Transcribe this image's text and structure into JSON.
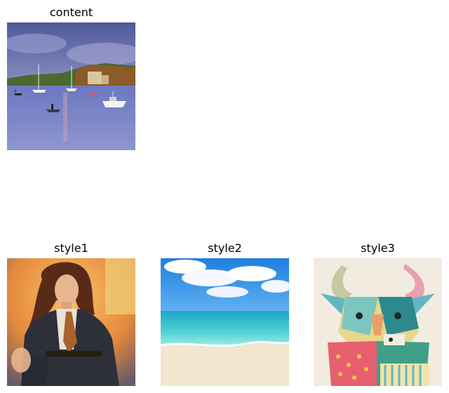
{
  "panels": {
    "content": {
      "title": "content",
      "image": "harbor-boats-photo"
    },
    "style1": {
      "title": "style1",
      "image": "woman-in-blazer-painting"
    },
    "style2": {
      "title": "style2",
      "image": "tropical-beach-photo"
    },
    "style3": {
      "title": "style3",
      "image": "geometric-bull-illustration"
    }
  }
}
